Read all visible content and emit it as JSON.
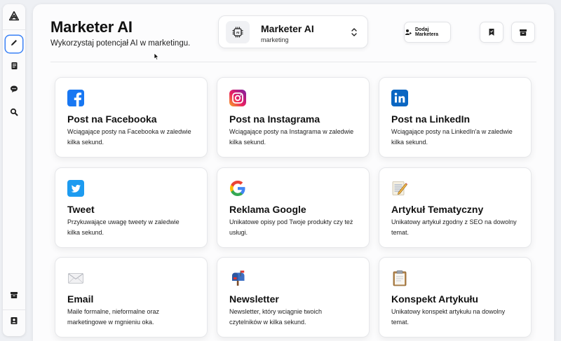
{
  "sidebar": {
    "logo": "knot-logo-icon",
    "items": [
      {
        "name": "pencil-icon",
        "active": true
      },
      {
        "name": "document-icon",
        "active": false
      },
      {
        "name": "chat-icon",
        "active": false
      },
      {
        "name": "search-icon",
        "active": false
      }
    ],
    "bottom": [
      {
        "name": "archive-icon"
      },
      {
        "name": "user-card-icon"
      }
    ]
  },
  "header": {
    "title": "Marketer AI",
    "subtitle": "Wykorzystaj potencjał AI w marketingu.",
    "switcher": {
      "name": "Marketer AI",
      "category": "marketing"
    },
    "add_button_label": "Dodaj Marketera"
  },
  "tools": [
    {
      "title": "Post na Facebooka",
      "desc": "Wciągające posty na Facebooka w zaledwie kilka sekund.",
      "icon": "facebook-icon"
    },
    {
      "title": "Post na Instagrama",
      "desc": "Wciągające posty na Instagrama w zaledwie kilka sekund.",
      "icon": "instagram-icon"
    },
    {
      "title": "Post na LinkedIn",
      "desc": "Wciągające posty na LinkedIn'a w zaledwie kilka sekund.",
      "icon": "linkedin-icon"
    },
    {
      "title": "Tweet",
      "desc": "Przykuwające uwagę tweety w zaledwie kilka sekund.",
      "icon": "twitter-icon"
    },
    {
      "title": "Reklama Google",
      "desc": "Unikatowe opisy pod Twoje produkty czy też usługi.",
      "icon": "google-icon"
    },
    {
      "title": "Artykuł Tematyczny",
      "desc": "Unikatowy artykuł zgodny z SEO na dowolny temat.",
      "icon": "memo-icon"
    },
    {
      "title": "Email",
      "desc": "Maile formalne, nieformalne oraz marketingowe w mgnieniu oka.",
      "icon": "envelope-icon"
    },
    {
      "title": "Newsletter",
      "desc": "Newsletter, który wciągnie twoich czytelników w kilka sekund.",
      "icon": "mailbox-icon"
    },
    {
      "title": "Konspekt Artykułu",
      "desc": "Unikatowy konspekt artykułu na dowolny temat.",
      "icon": "clipboard-icon"
    }
  ],
  "colors": {
    "accent": "#3b82f6",
    "facebook": "#1877f2",
    "linkedin": "#0a66c2",
    "twitter": "#1d9bf0"
  }
}
